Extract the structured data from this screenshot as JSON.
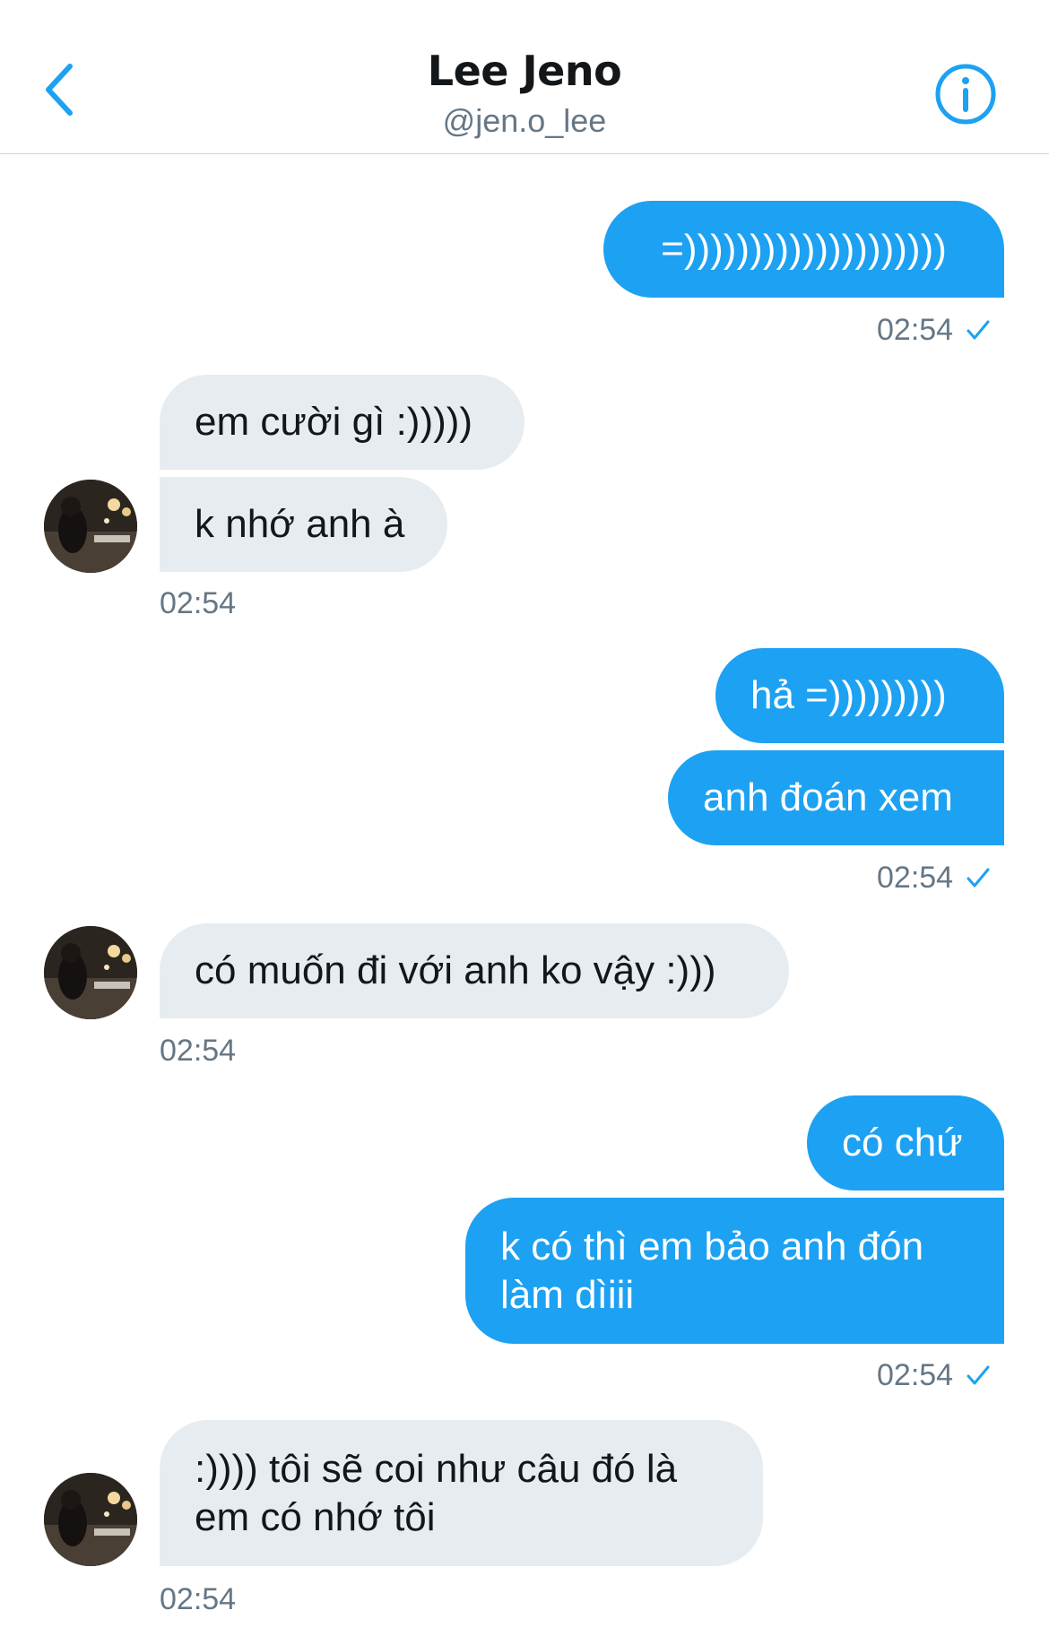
{
  "header": {
    "title": "Lee Jeno",
    "handle": "@jen.o_lee"
  },
  "colors": {
    "accent": "#1da1f2",
    "incoming_bubble": "#e6ecf0",
    "timestamp": "#657786"
  },
  "messages": [
    {
      "text": "=))))))))))))))))))))"
    },
    {
      "text": "em cười gì :)))))"
    },
    {
      "text": "k nhớ anh à"
    },
    {
      "text": "hả =)))))))))"
    },
    {
      "text": "anh đoán xem"
    },
    {
      "text": "có muốn đi với anh ko vậy :)))"
    },
    {
      "text": "có chứ"
    },
    {
      "text": "k có thì em bảo anh đón\nlàm dìiii"
    },
    {
      "text": ":)))) tôi sẽ coi như câu đó là\nem có nhớ tôi"
    }
  ],
  "timestamps": [
    "02:54",
    "02:54",
    "02:54",
    "02:54",
    "02:54",
    "02:54"
  ],
  "icons": {
    "back": "chevron-left-icon",
    "info": "info-circle-icon",
    "read_receipt": "checkmark-icon",
    "avatar": "user-avatar"
  }
}
